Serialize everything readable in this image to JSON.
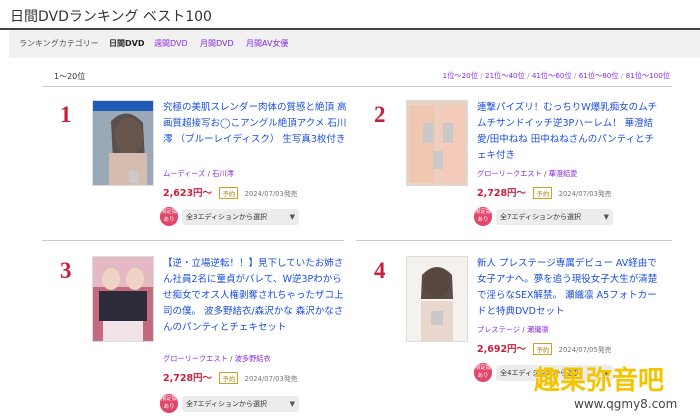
{
  "header": {
    "title": "日間DVDランキング ベスト100"
  },
  "category_bar": {
    "label": "ランキングカテゴリー",
    "items": [
      {
        "label": "日間DVD",
        "active": true
      },
      {
        "label": "週間DVD",
        "active": false
      },
      {
        "label": "月間DVD",
        "active": false
      },
      {
        "label": "月間AV女優",
        "active": false
      }
    ]
  },
  "range_bar": {
    "current": "1〜20位",
    "pages": [
      "1位〜20位",
      "21位〜40位",
      "41位〜60位",
      "61位〜80位",
      "81位〜100位"
    ]
  },
  "colors": {
    "accent_red": "#c8203b",
    "link_blue": "#1a4fe0",
    "link_purple": "#8a2be2",
    "badge_pink": "#e2466a"
  },
  "items": [
    {
      "rank": "1",
      "title": "究極の美肌スレンダー肉体の質感と絶頂 高画質超接写お◯こアングル絶頂アクメ 石川澪 （ブルーレイディスク） 生写真3枚付き",
      "maker": "ムーディーズ",
      "actor": "石川澪",
      "price": "2,623円〜",
      "badge": "予約",
      "release": "2024/07/03発売",
      "limited": "限定版あり",
      "select": "全3エディションから選択"
    },
    {
      "rank": "2",
      "title": "連撃パイズリ！むっちりW爆乳痴女のムチムチサンドイッチ逆3Pハーレム！ 華澄結愛/田中ねね 田中ねねさんのパンティとチェキ付き",
      "maker": "グローリークエスト",
      "actor": "華澄結愛",
      "price": "2,728円〜",
      "badge": "予約",
      "release": "2024/07/03発売",
      "limited": "限定版あり",
      "select": "全7エディションから選択"
    },
    {
      "rank": "3",
      "title": "【逆・立場逆転！！】見下していたお姉さん社員2名に童貞がバレて、W逆3Pわからせ痴女でオス人権剥奪されちゃったザコ上司の僕。 波多野結衣/森沢かな 森沢かなさんのパンティとチェキセット",
      "maker": "グローリークエスト",
      "actor": "波多野結衣",
      "price": "2,728円〜",
      "badge": "予約",
      "release": "2024/07/03発売",
      "limited": "限定版あり",
      "select": "全7エディションから選択"
    },
    {
      "rank": "4",
      "title": "新人 プレステージ専属デビュー AV経由で女子アナへ。夢を追う現役女子大生が清楚で淫らなSEX解禁。 瀬織凛 A5フォトカードと特典DVDセット",
      "maker": "プレステージ",
      "actor": "瀬織凛",
      "price": "2,692円〜",
      "badge": "予約",
      "release": "2024/07/05発売",
      "limited": "限定版あり",
      "select": "全4エディションから選択"
    }
  ],
  "watermark": {
    "text": "趣果弥音吧",
    "url": "www.qgmy8.com"
  }
}
